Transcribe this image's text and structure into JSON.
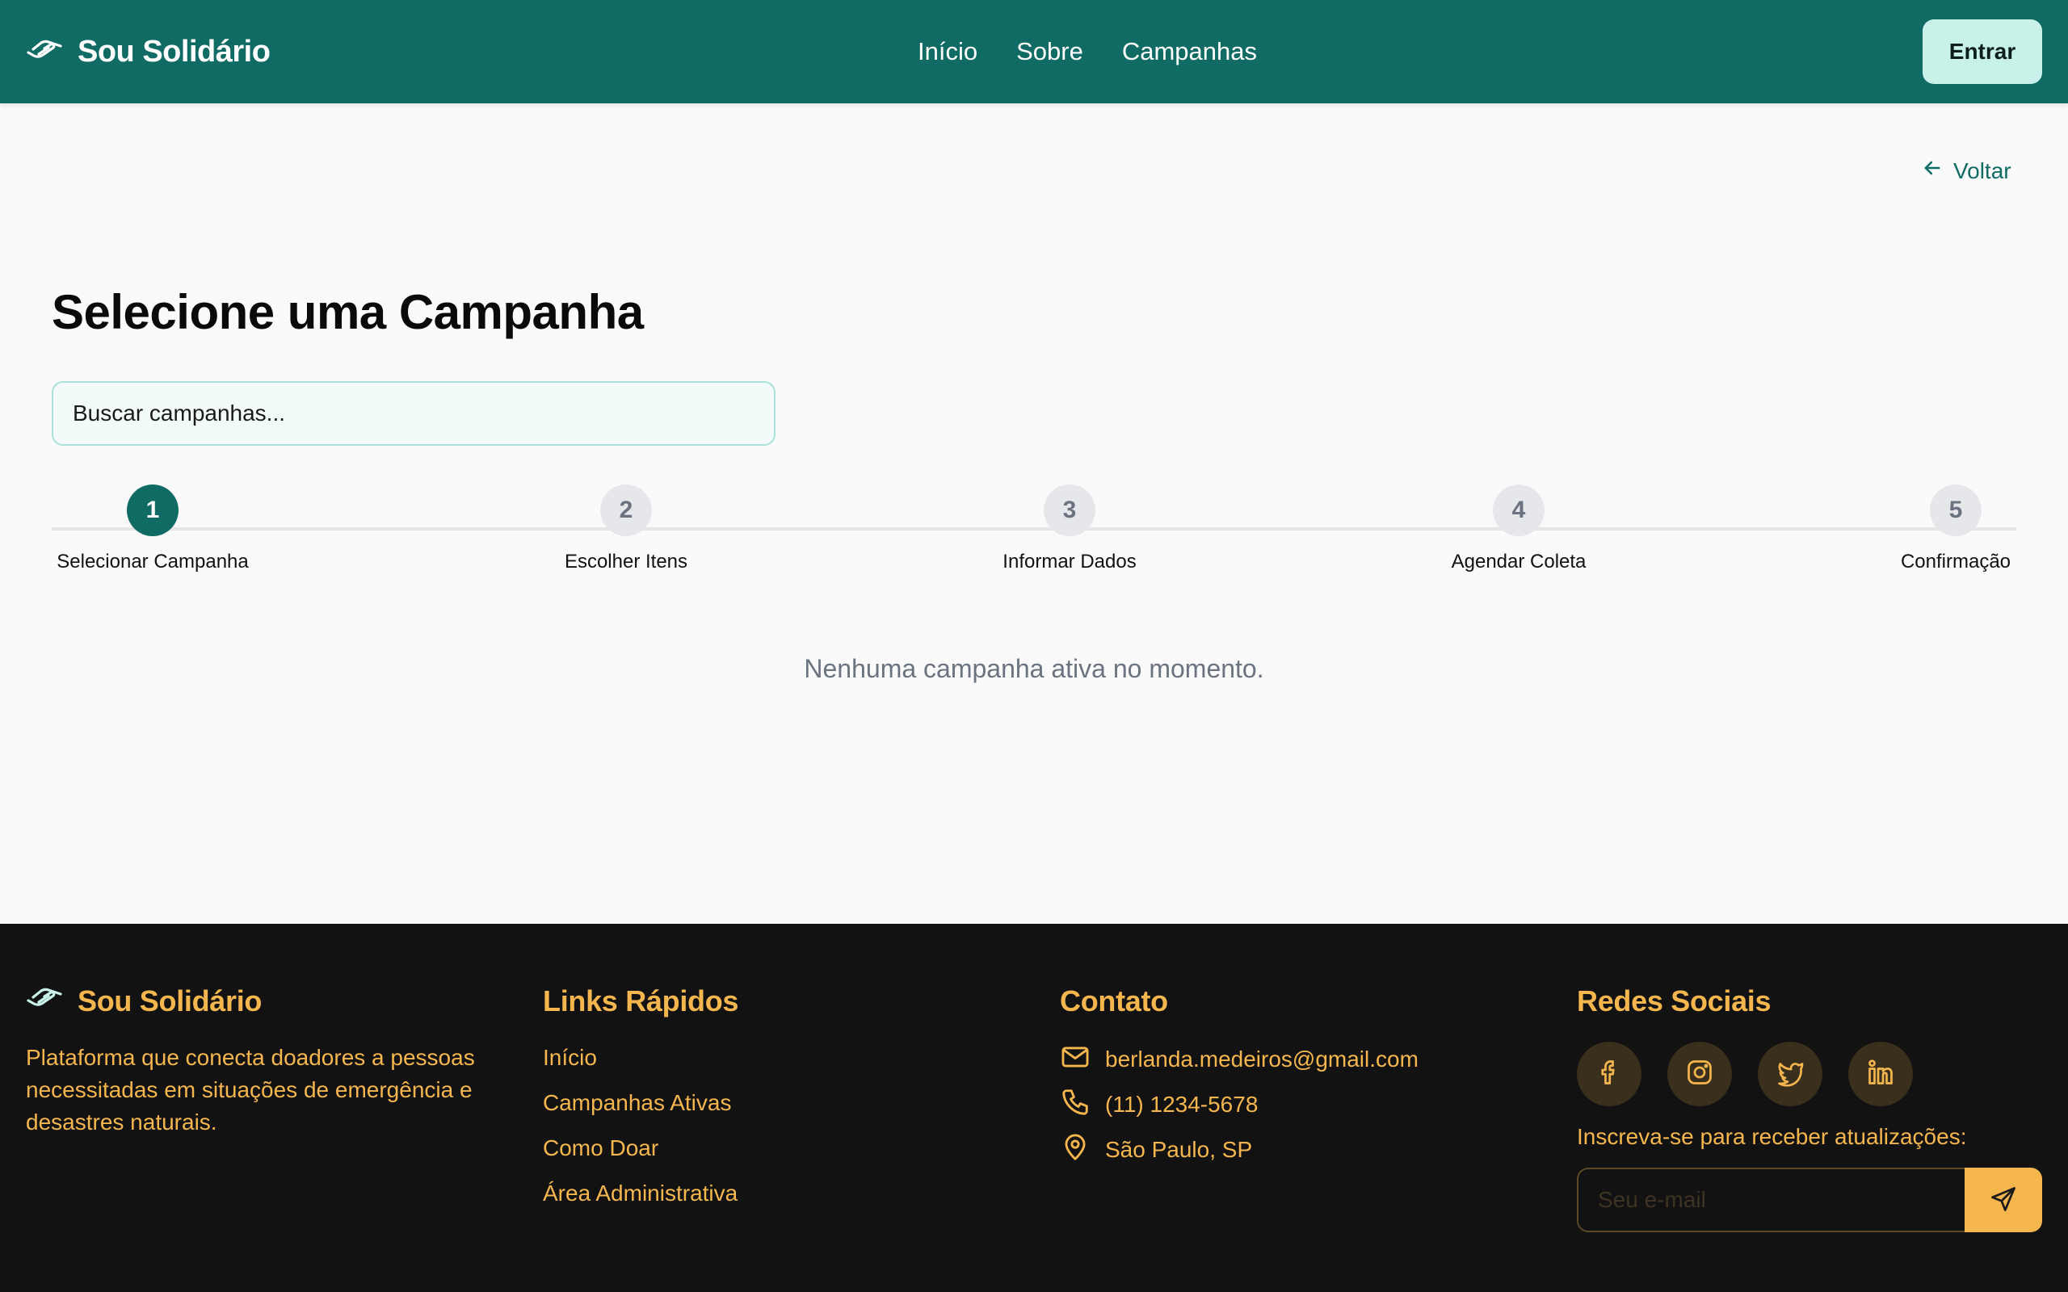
{
  "header": {
    "brand": "Sou Solidário",
    "nav": [
      "Início",
      "Sobre",
      "Campanhas"
    ],
    "login_label": "Entrar"
  },
  "main": {
    "back_label": "Voltar",
    "title": "Selecione uma Campanha",
    "search_placeholder": "Buscar campanhas...",
    "steps": [
      {
        "number": "1",
        "label": "Selecionar Campanha",
        "active": true
      },
      {
        "number": "2",
        "label": "Escolher Itens",
        "active": false
      },
      {
        "number": "3",
        "label": "Informar Dados",
        "active": false
      },
      {
        "number": "4",
        "label": "Agendar Coleta",
        "active": false
      },
      {
        "number": "5",
        "label": "Confirmação",
        "active": false
      }
    ],
    "empty_message": "Nenhuma campanha ativa no momento."
  },
  "footer": {
    "brand": "Sou Solidário",
    "description": "Plataforma que conecta doadores a pessoas necessitadas em situações de emergência e desastres naturais.",
    "links_title": "Links Rápidos",
    "links": [
      "Início",
      "Campanhas Ativas",
      "Como Doar",
      "Área Administrativa"
    ],
    "contact_title": "Contato",
    "contact": {
      "email": "berlanda.medeiros@gmail.com",
      "phone": "(11) 1234-5678",
      "location": "São Paulo, SP"
    },
    "social_title": "Redes Sociais",
    "socials": [
      "facebook-icon",
      "instagram-icon",
      "twitter-icon",
      "linkedin-icon"
    ],
    "subscribe_label": "Inscreva-se para receber atualizações:",
    "subscribe_placeholder": "Seu e-mail"
  },
  "colors": {
    "primary": "#0f6b63",
    "accent": "#f5b64d",
    "login_bg": "#c8f1ea",
    "footer_bg": "#121212"
  }
}
